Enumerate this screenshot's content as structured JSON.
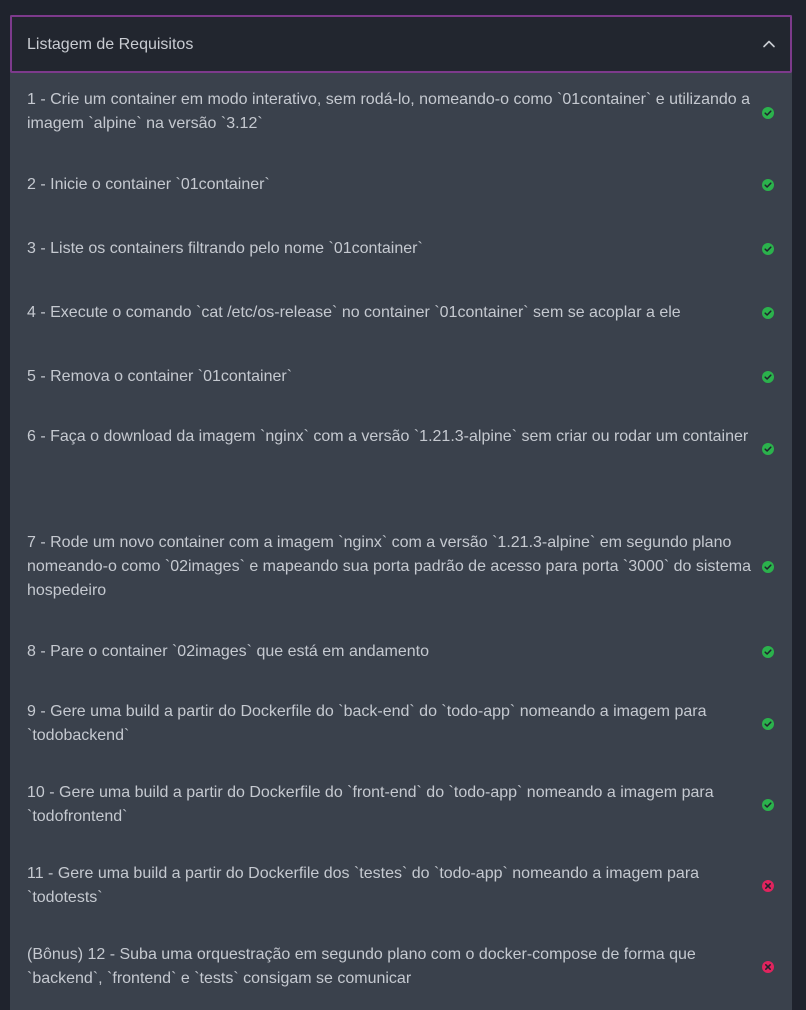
{
  "header": {
    "title": "Listagem de Requisitos",
    "toggle_icon": "chevron-up-icon"
  },
  "colors": {
    "pass": "#2bb24c",
    "fail": "#e0245e",
    "accent_border": "#7d3a8c"
  },
  "requirements": [
    {
      "text": "1 - Crie um container em modo interativo, sem rodá-lo, nomeando-o como `01container` e utilizando a imagem `alpine` na versão `3.12`",
      "status": "pass"
    },
    {
      "text": "2 - Inicie o container `01container`",
      "status": "pass"
    },
    {
      "text": "3 - Liste os containers filtrando pelo nome `01container`",
      "status": "pass"
    },
    {
      "text": "4 - Execute o comando `cat /etc/os-release` no container `01container` sem se acoplar a ele",
      "status": "pass"
    },
    {
      "text": "5 - Remova o container `01container`",
      "status": "pass"
    },
    {
      "text": "6 - Faça o download da imagem `nginx` com a versão `1.21.3-alpine` sem criar ou rodar um container",
      "status": "pass"
    },
    {
      "text": "7 - Rode um novo container com a imagem `nginx` com a versão `1.21.3-alpine` em segundo plano nomeando-o como `02images` e mapeando sua porta padrão de acesso para porta `3000` do sistema hospedeiro",
      "status": "pass"
    },
    {
      "text": "8 - Pare o container `02images` que está em andamento",
      "status": "pass"
    },
    {
      "text": "9 - Gere uma build a partir do Dockerfile do `back-end` do `todo-app` nomeando a imagem para `todobackend`",
      "status": "pass"
    },
    {
      "text": "10 - Gere uma build a partir do Dockerfile do `front-end` do `todo-app` nomeando a imagem para `todofrontend`",
      "status": "pass"
    },
    {
      "text": "11 - Gere uma build a partir do Dockerfile dos `testes` do `todo-app` nomeando a imagem para `todotests`",
      "status": "fail"
    },
    {
      "text": "(Bônus) 12 - Suba uma orquestração em segundo plano com o docker-compose de forma que `backend`, `frontend` e `tests` consigam se comunicar",
      "status": "fail"
    }
  ]
}
